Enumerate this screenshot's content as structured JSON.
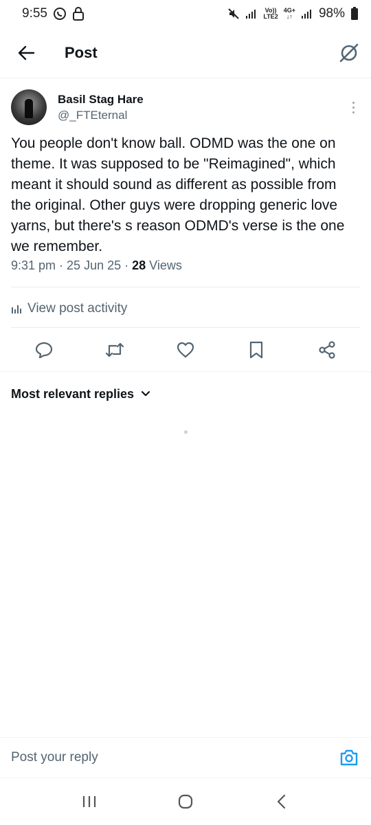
{
  "status_bar": {
    "time": "9:55",
    "network_top": "Vo))",
    "network_bottom": "LTE2",
    "network2_top": "4G+",
    "battery": "98%"
  },
  "header": {
    "title": "Post"
  },
  "post": {
    "display_name": "Basil Stag Hare",
    "username": "@_FTEternal",
    "text": "You people don't know ball. ODMD was the one on theme. It was supposed to be \"Reimagined\", which meant it should sound as different as possible from the original. Other guys were dropping generic love yarns, but there's s reason ODMD's verse is the one we remember.",
    "time": "9:31 pm",
    "date": "25 Jun 25",
    "separator": "·",
    "views_count": "28",
    "views_label": "Views",
    "activity_label": "View post activity"
  },
  "replies": {
    "sort_label": "Most relevant replies"
  },
  "reply_bar": {
    "placeholder": "Post your reply"
  },
  "colors": {
    "text": "#0f1419",
    "secondary": "#536471",
    "accent": "#1d9bf0"
  }
}
